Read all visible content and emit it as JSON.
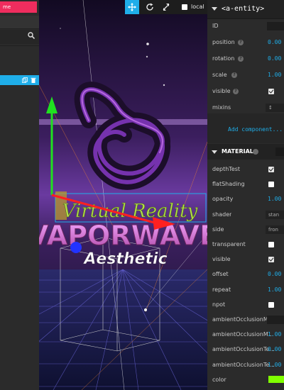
{
  "scene_panel": {
    "top_button_label": "me",
    "search_icon": "search-icon",
    "selected_row_icons": [
      "copy-icon",
      "trash-icon"
    ]
  },
  "viewport": {
    "toolbar": {
      "translate_icon": "move-icon",
      "rotate_icon": "rotate-icon",
      "scale_icon": "expand-icon",
      "local_label": "local",
      "local_checked": false
    },
    "scene_text": {
      "line1": "Virtual Reality",
      "line2": "VAPORWAVE",
      "line3": "Aesthetic"
    },
    "colors": {
      "accent": "#1faee9",
      "gizmo_x": "#ff2020",
      "gizmo_y": "#20e020",
      "gizmo_z": "#2040ff"
    }
  },
  "inspector": {
    "entity_title": "<a-entity>",
    "properties": [
      {
        "label": "ID",
        "help": false,
        "kind": "field",
        "value": ""
      },
      {
        "label": "position",
        "help": true,
        "kind": "value",
        "value": "0.00"
      },
      {
        "label": "rotation",
        "help": true,
        "kind": "value",
        "value": "0.00"
      },
      {
        "label": "scale",
        "help": true,
        "kind": "value",
        "value": "1.00"
      },
      {
        "label": "visible",
        "help": true,
        "kind": "check",
        "checked": true
      },
      {
        "label": "mixins",
        "help": false,
        "kind": "select",
        "value": "↕"
      }
    ],
    "add_component_label": "Add component...",
    "material": {
      "title": "MATERIAL",
      "properties": [
        {
          "label": "depthTest",
          "kind": "check",
          "checked": true
        },
        {
          "label": "flatShading",
          "kind": "check",
          "checked": false
        },
        {
          "label": "opacity",
          "kind": "value",
          "value": "1.00"
        },
        {
          "label": "shader",
          "kind": "select",
          "value": "stan"
        },
        {
          "label": "side",
          "kind": "select",
          "value": "fron"
        },
        {
          "label": "transparent",
          "kind": "check",
          "checked": false
        },
        {
          "label": "visible",
          "kind": "check",
          "checked": true
        },
        {
          "label": "offset",
          "kind": "value",
          "value": "0.00"
        },
        {
          "label": "repeat",
          "kind": "value",
          "value": "1.00"
        },
        {
          "label": "npot",
          "kind": "check",
          "checked": false
        },
        {
          "label": "ambientOcclusionM...",
          "kind": "field",
          "value": ""
        },
        {
          "label": "ambientOcclusionM...",
          "kind": "value",
          "value": "1.00"
        },
        {
          "label": "ambientOcclusionTe...",
          "kind": "value",
          "value": "0.00"
        },
        {
          "label": "ambientOcclusionTe...",
          "kind": "value",
          "value": "1.00"
        },
        {
          "label": "color",
          "kind": "color",
          "value": "#80ff00"
        }
      ]
    }
  }
}
